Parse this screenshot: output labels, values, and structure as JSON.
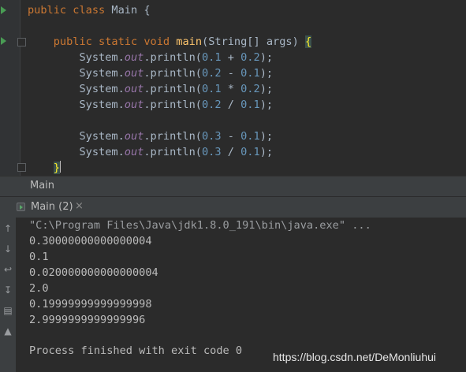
{
  "editor": {
    "lines": [
      {
        "parts": [
          {
            "c": "kw",
            "t": "public "
          },
          {
            "c": "kw",
            "t": "class "
          },
          {
            "c": "",
            "t": "Main {"
          }
        ]
      },
      {
        "parts": []
      },
      {
        "parts": [
          {
            "c": "",
            "t": "    "
          },
          {
            "c": "kw",
            "t": "public "
          },
          {
            "c": "kw",
            "t": "static "
          },
          {
            "c": "kw",
            "t": "void "
          },
          {
            "c": "fn",
            "t": "main"
          },
          {
            "c": "",
            "t": "(String[] args) "
          },
          {
            "c": "brace-hl",
            "t": "{"
          }
        ]
      },
      {
        "parts": [
          {
            "c": "",
            "t": "        System."
          },
          {
            "c": "it",
            "t": "out"
          },
          {
            "c": "",
            "t": ".println("
          },
          {
            "c": "num",
            "t": "0.1"
          },
          {
            "c": "",
            "t": " + "
          },
          {
            "c": "num",
            "t": "0.2"
          },
          {
            "c": "",
            "t": ");"
          }
        ]
      },
      {
        "parts": [
          {
            "c": "",
            "t": "        System."
          },
          {
            "c": "it",
            "t": "out"
          },
          {
            "c": "",
            "t": ".println("
          },
          {
            "c": "num",
            "t": "0.2"
          },
          {
            "c": "",
            "t": " - "
          },
          {
            "c": "num",
            "t": "0.1"
          },
          {
            "c": "",
            "t": ");"
          }
        ]
      },
      {
        "parts": [
          {
            "c": "",
            "t": "        System."
          },
          {
            "c": "it",
            "t": "out"
          },
          {
            "c": "",
            "t": ".println("
          },
          {
            "c": "num",
            "t": "0.1"
          },
          {
            "c": "",
            "t": " * "
          },
          {
            "c": "num",
            "t": "0.2"
          },
          {
            "c": "",
            "t": ");"
          }
        ]
      },
      {
        "parts": [
          {
            "c": "",
            "t": "        System."
          },
          {
            "c": "it",
            "t": "out"
          },
          {
            "c": "",
            "t": ".println("
          },
          {
            "c": "num",
            "t": "0.2"
          },
          {
            "c": "",
            "t": " / "
          },
          {
            "c": "num",
            "t": "0.1"
          },
          {
            "c": "",
            "t": ");"
          }
        ]
      },
      {
        "parts": []
      },
      {
        "parts": [
          {
            "c": "",
            "t": "        System."
          },
          {
            "c": "it",
            "t": "out"
          },
          {
            "c": "",
            "t": ".println("
          },
          {
            "c": "num",
            "t": "0.3"
          },
          {
            "c": "",
            "t": " - "
          },
          {
            "c": "num",
            "t": "0.1"
          },
          {
            "c": "",
            "t": ");"
          }
        ]
      },
      {
        "parts": [
          {
            "c": "",
            "t": "        System."
          },
          {
            "c": "it",
            "t": "out"
          },
          {
            "c": "",
            "t": ".println("
          },
          {
            "c": "num",
            "t": "0.3"
          },
          {
            "c": "",
            "t": " / "
          },
          {
            "c": "num",
            "t": "0.1"
          },
          {
            "c": "",
            "t": ");"
          }
        ]
      },
      {
        "parts": [
          {
            "c": "",
            "t": "    "
          },
          {
            "c": "brace-hl",
            "t": "}"
          }
        ],
        "caret": true
      }
    ]
  },
  "breadcrumb": "Main",
  "run_tab": {
    "label": "Main (2)",
    "close": "×"
  },
  "console": {
    "command": "\"C:\\Program Files\\Java\\jdk1.8.0_191\\bin\\java.exe\" ...",
    "output": [
      "0.30000000000000004",
      "0.1",
      "0.020000000000000004",
      "2.0",
      "0.19999999999999998",
      "2.9999999999999996",
      ""
    ],
    "exit": "Process finished with exit code 0"
  },
  "toolbar_icons": [
    "arrow-up-icon",
    "arrow-down-icon",
    "soft-wrap-icon",
    "scroll-to-end-icon",
    "print-icon",
    "trash-icon"
  ],
  "watermark": "https://blog.csdn.net/DeMonliuhui"
}
